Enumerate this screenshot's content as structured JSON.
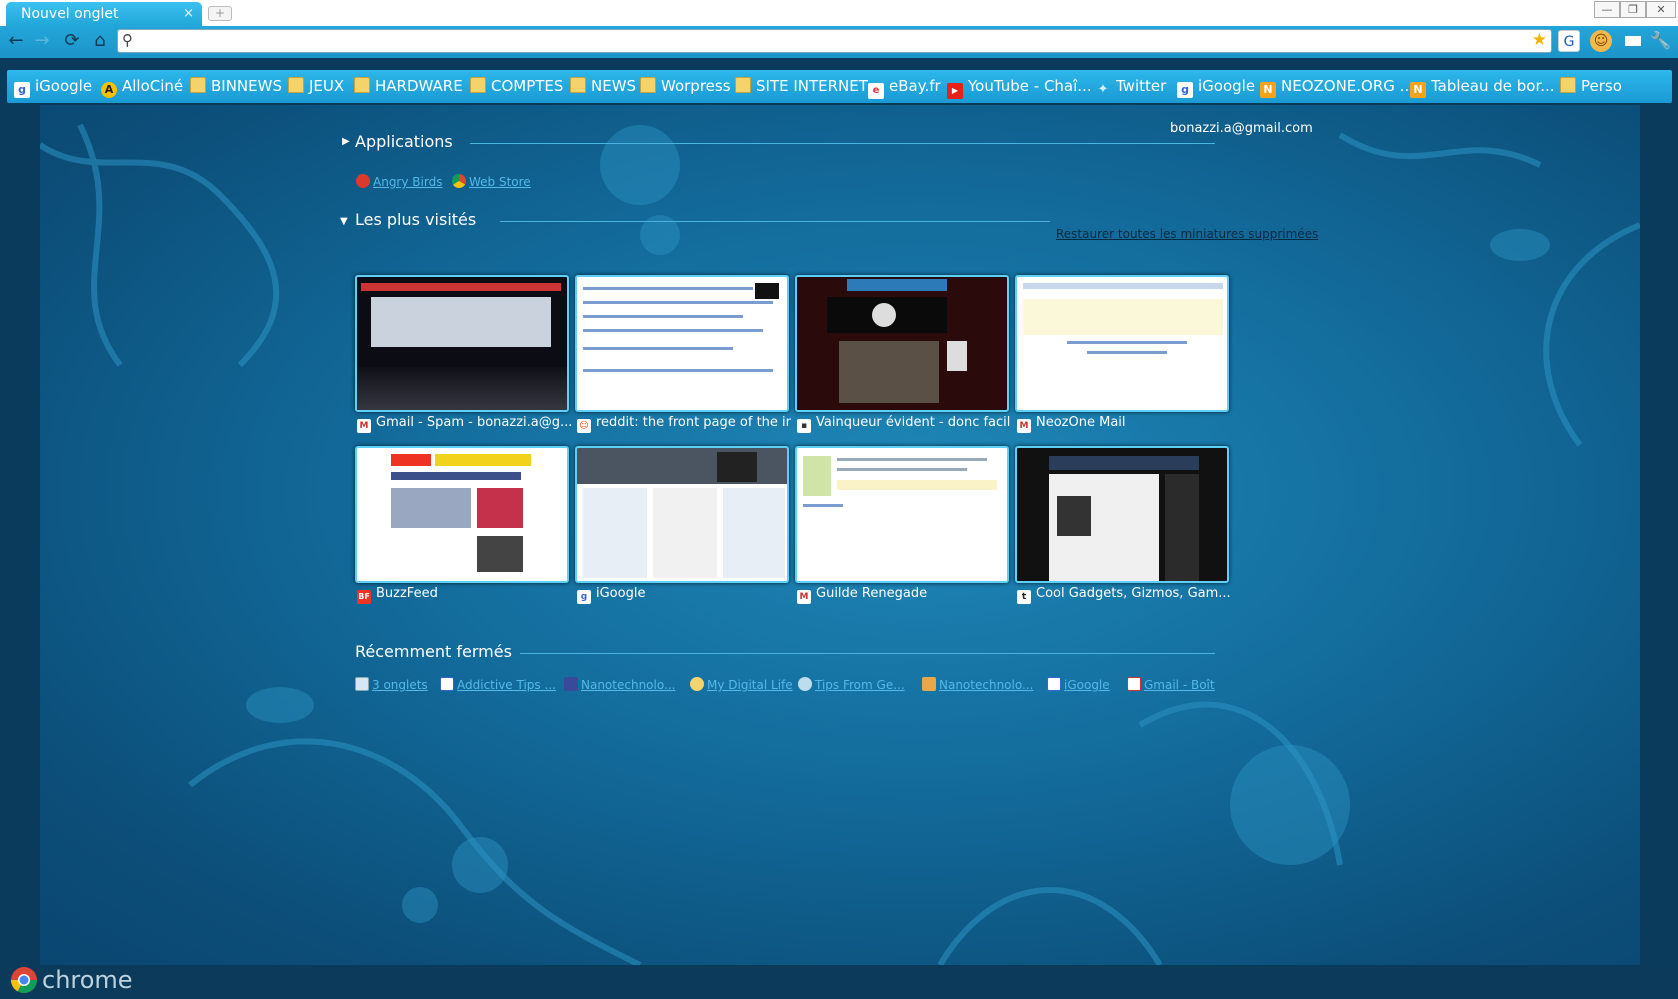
{
  "window": {
    "tab_title": "Nouvel onglet",
    "tab_close": "×",
    "new_tab": "+",
    "minimize": "—",
    "restore": "❐",
    "close": "✕"
  },
  "toolbar": {
    "back": "←",
    "forward": "→",
    "reload": "⟳",
    "home": "⌂",
    "omnibox_value": "",
    "omnibox_placeholder": "",
    "search_glyph": "⚲",
    "star": "★"
  },
  "bookmarks": [
    {
      "label": "iGoogle",
      "icon": "google-icon"
    },
    {
      "label": "AlloCiné",
      "icon": "allocine-icon"
    },
    {
      "label": "BINNEWS",
      "icon": "folder-icon"
    },
    {
      "label": "JEUX",
      "icon": "folder-icon"
    },
    {
      "label": "HARDWARE",
      "icon": "folder-icon"
    },
    {
      "label": "COMPTES",
      "icon": "folder-icon"
    },
    {
      "label": "NEWS",
      "icon": "folder-icon"
    },
    {
      "label": "Worpress",
      "icon": "folder-icon"
    },
    {
      "label": "SITE INTERNET",
      "icon": "folder-icon"
    },
    {
      "label": "eBay.fr",
      "icon": "ebay-icon"
    },
    {
      "label": "YouTube - Chaî...",
      "icon": "youtube-icon"
    },
    {
      "label": "Twitter",
      "icon": "twitter-icon"
    },
    {
      "label": "iGoogle",
      "icon": "google-icon"
    },
    {
      "label": "NEOZONE.ORG ...",
      "icon": "neozone-icon"
    },
    {
      "label": "Tableau de bor...",
      "icon": "neozone-icon"
    },
    {
      "label": "Perso",
      "icon": "folder-icon"
    }
  ],
  "user_email": "bonazzi.a@gmail.com",
  "applications": {
    "title": "Applications",
    "items": [
      {
        "label": "Angry Birds",
        "icon": "angry-birds-icon"
      },
      {
        "label": "Web Store",
        "icon": "chrome-web-store-icon"
      }
    ]
  },
  "most_visited": {
    "title": "Les plus visités",
    "restore_link": "Restaurer toutes les miniatures supprimées",
    "items": [
      {
        "title": "Gmail - Spam - bonazzi.a@g...",
        "fav": "gmail-icon"
      },
      {
        "title": "reddit: the front page of the int...",
        "fav": "reddit-icon"
      },
      {
        "title": "Vainqueur évident - donc facil...",
        "fav": "page-icon"
      },
      {
        "title": "NeozOne Mail",
        "fav": "gmail-icon"
      },
      {
        "title": "BuzzFeed",
        "fav": "buzzfeed-icon"
      },
      {
        "title": "iGoogle",
        "fav": "google-icon"
      },
      {
        "title": "Guilde Renegade",
        "fav": "gmail-icon"
      },
      {
        "title": "Cool Gadgets, Gizmos, Gam...",
        "fav": "technabob-icon"
      }
    ]
  },
  "recently_closed": {
    "title": "Récemment fermés",
    "items": [
      {
        "label": "3 onglets",
        "icon": "window-icon"
      },
      {
        "label": "Addictive Tips ...",
        "icon": "addictive-tips-icon"
      },
      {
        "label": "Nanotechnolo...",
        "icon": "nano-icon"
      },
      {
        "label": "My Digital Life",
        "icon": "bulb-icon"
      },
      {
        "label": "Tips From Ge...",
        "icon": "tips-icon"
      },
      {
        "label": "Nanotechnolo...",
        "icon": "nano-icon"
      },
      {
        "label": "iGoogle",
        "icon": "google-icon"
      },
      {
        "label": "Gmail - Boîte d...",
        "icon": "gmail-icon"
      }
    ]
  },
  "footer": {
    "brand": "chrome"
  },
  "colors": {
    "accent": "#1ea0d6",
    "link": "#54b9e8",
    "thumb_border": "#5fd0f5"
  }
}
